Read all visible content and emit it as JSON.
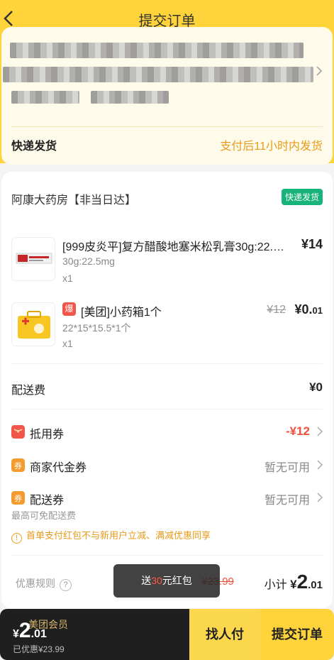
{
  "nav": {
    "title": "提交订单"
  },
  "delivery": {
    "label": "快递发货",
    "promise": "支付后11小时内发货"
  },
  "store": {
    "name": "阿康大药房【非当日达】",
    "badge": "快递发货"
  },
  "products": [
    {
      "name": "[999皮炎平]复方醋酸地塞米松乳膏30g:22.5mg",
      "spec": "30g:22.5mg",
      "qty": "x1",
      "price": "¥14"
    },
    {
      "tag": "爆",
      "name": "[美团]小药箱1个",
      "spec": "22*15*15.5*1个",
      "qty": "x1",
      "old_price": "¥12",
      "price_yen": "¥0.",
      "price_cents": "01"
    }
  ],
  "fees": {
    "shipping_label": "配送费",
    "shipping_value": "¥0",
    "coupon_label": "抵用券",
    "coupon_value": "-¥12",
    "merchant_label": "商家代金券",
    "merchant_value": "暂无可用",
    "delivery_coupon_label": "配送券",
    "delivery_coupon_value": "暂无可用",
    "delivery_coupon_note": "最高可免配送费",
    "warning": "首单支付红包不与新用户立减、满减优惠同享"
  },
  "summary": {
    "rules_label": "优惠规则",
    "subtotal_label": "小计",
    "yen": "¥",
    "total_int": "2",
    "total_dec": ".01",
    "saved_strike": "¥23.99"
  },
  "toast": {
    "prefix": "送",
    "highlight": "30",
    "suffix": "元红包"
  },
  "bottom": {
    "member": "美团会员",
    "yen": "¥",
    "total_int": "2",
    "total_dec": ".01",
    "saved": "已优惠¥23.99",
    "find_label": "找人付",
    "submit_label": "提交订单"
  },
  "colors": {
    "brand_yellow": "#ffd43a",
    "accent_orange": "#e89a1a",
    "price_red": "#f0503c",
    "green_badge": "#17b37a"
  }
}
